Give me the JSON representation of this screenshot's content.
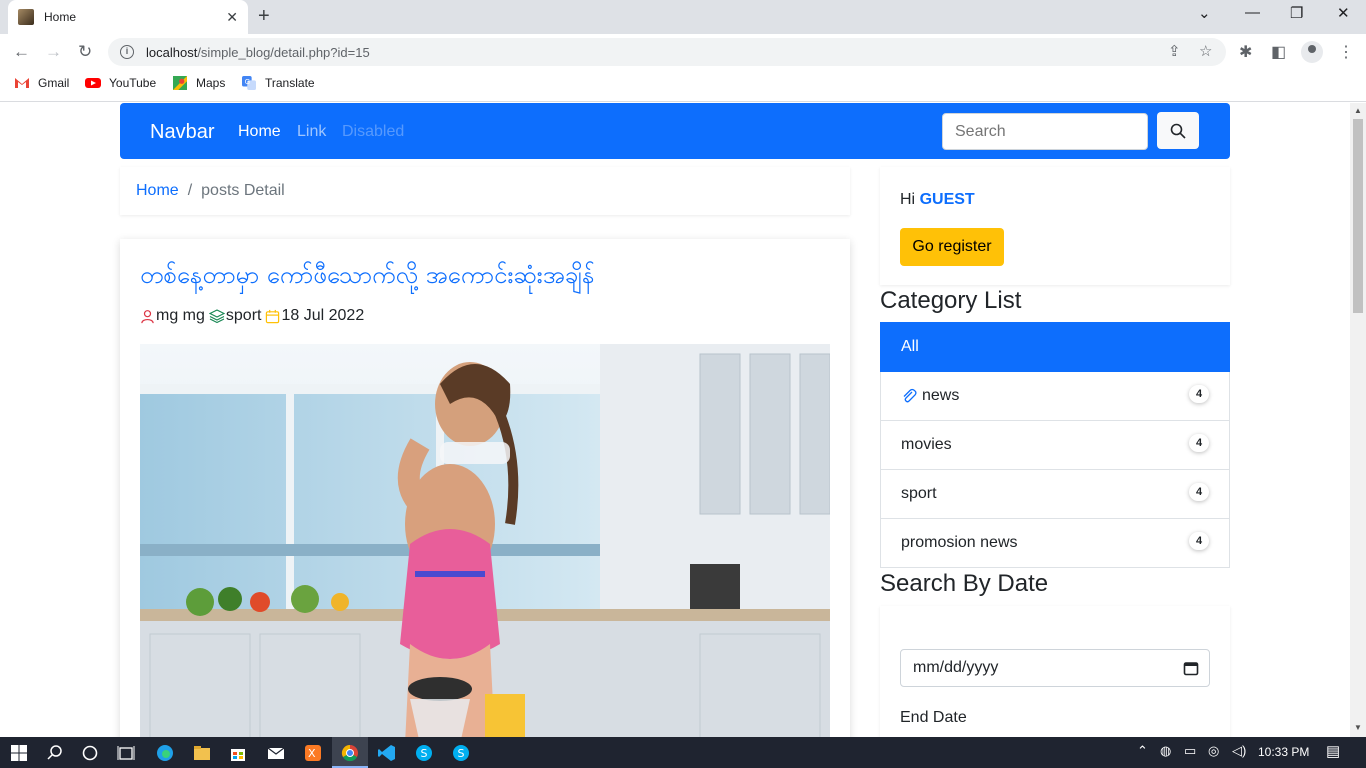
{
  "browser": {
    "tab_title": "Home",
    "url_host": "localhost",
    "url_path": "/simple_blog/detail.php?id=15",
    "bookmarks": [
      {
        "label": "Gmail",
        "icon": "gmail-icon"
      },
      {
        "label": "YouTube",
        "icon": "youtube-icon"
      },
      {
        "label": "Maps",
        "icon": "maps-icon"
      },
      {
        "label": "Translate",
        "icon": "translate-icon"
      }
    ]
  },
  "navbar": {
    "brand": "Navbar",
    "links": [
      {
        "label": "Home",
        "state": "active"
      },
      {
        "label": "Link",
        "state": "normal"
      },
      {
        "label": "Disabled",
        "state": "disabled"
      }
    ],
    "search_placeholder": "Search"
  },
  "breadcrumb": {
    "home": "Home",
    "separator": "/",
    "current": "posts Detail"
  },
  "post": {
    "title": "တစ်နေ့တာမှာ ကော်ဖီသောက်လို့ အကောင်းဆုံးအချိန်",
    "author": "mg mg",
    "category": "sport",
    "date": "18 Jul 2022"
  },
  "sidebar": {
    "greeting": "Hi",
    "user": "GUEST",
    "register_label": "Go register",
    "category_title": "Category List",
    "categories": [
      {
        "label": "All",
        "active": true
      },
      {
        "label": "news",
        "count": "4",
        "icon": "paperclip-icon"
      },
      {
        "label": "movies",
        "count": "4"
      },
      {
        "label": "sport",
        "count": "4"
      },
      {
        "label": "promosion news",
        "count": "4"
      }
    ],
    "date_title": "Search By Date",
    "date_placeholder": "mm/dd/yyyy",
    "end_label": "End Date"
  },
  "taskbar": {
    "time": "10:33 PM"
  },
  "colors": {
    "primary": "#0d6efd",
    "warning": "#ffc107"
  }
}
